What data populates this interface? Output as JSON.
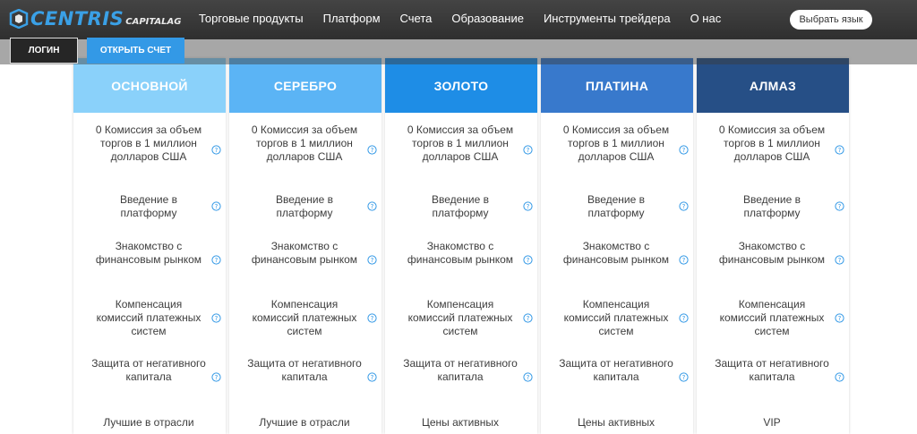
{
  "header": {
    "logo": {
      "main": "CENTRIS",
      "sub": "CAPITALAG"
    },
    "nav": [
      "Торговые продукты",
      "Платформ",
      "Счета",
      "Образование",
      "Инструменты трейдера",
      "О нас"
    ],
    "language_button": "Выбрать язык",
    "login_button": "ЛОГИН",
    "open_account_button": "ОТКРЫТЬ СЧЕТ"
  },
  "colors": {
    "accent": "#3399e6",
    "plans": [
      "#8ad1fa",
      "#5bb4f5",
      "#1e8de6",
      "#3879cc",
      "#264f86"
    ]
  },
  "plans": [
    {
      "name": "ОСНОВНОЙ",
      "features": [
        "0 Комиссия за объем торгов в 1 миллион долларов США",
        "Введение в платформу",
        "Знакомство с финансовым рынком",
        "Компенсация комиссий платежных систем",
        "Защита от негативного капитала",
        "Лучшие в отрасли"
      ]
    },
    {
      "name": "СЕРЕБРО",
      "features": [
        "0 Комиссия за объем торгов в 1 миллион долларов США",
        "Введение в платформу",
        "Знакомство с финансовым рынком",
        "Компенсация комиссий платежных систем",
        "Защита от негативного капитала",
        "Лучшие в отрасли"
      ]
    },
    {
      "name": "ЗОЛОТО",
      "features": [
        "0 Комиссия за объем торгов в 1 миллион долларов США",
        "Введение в платформу",
        "Знакомство с финансовым рынком",
        "Компенсация комиссий платежных систем",
        "Защита от негативного капитала",
        "Цены активных"
      ]
    },
    {
      "name": "ПЛАТИНА",
      "features": [
        "0 Комиссия за объем торгов в 1 миллион долларов США",
        "Введение в платформу",
        "Знакомство с финансовым рынком",
        "Компенсация комиссий платежных систем",
        "Защита от негативного капитала",
        "Цены активных"
      ]
    },
    {
      "name": "АЛМАЗ",
      "features": [
        "0 Комиссия за объем торгов в 1 миллион долларов США",
        "Введение в платформу",
        "Знакомство с финансовым рынком",
        "Компенсация комиссий платежных систем",
        "Защита от негативного капитала",
        "VIP "
      ]
    }
  ]
}
